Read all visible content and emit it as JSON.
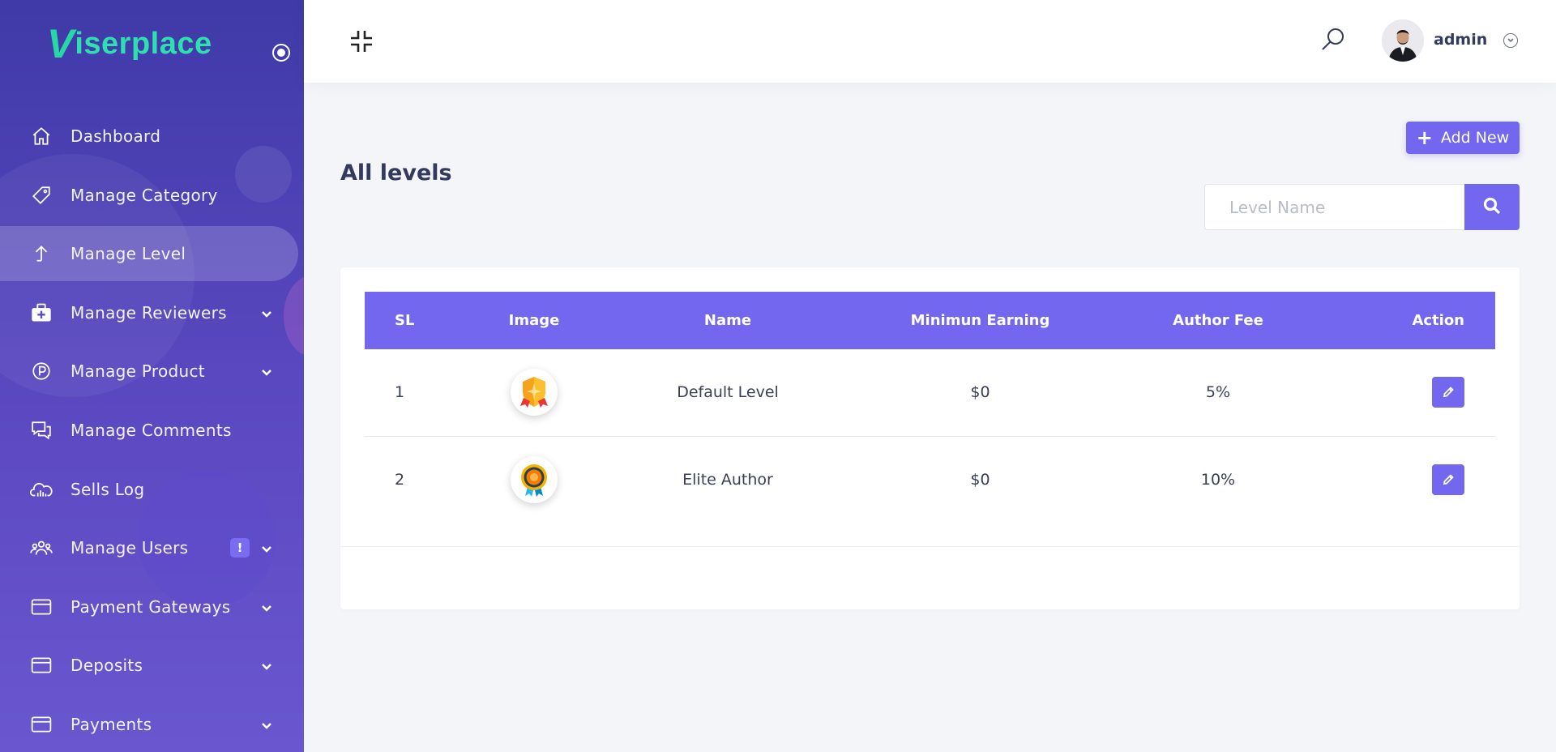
{
  "brand": {
    "logo_initial": "V",
    "logo_text": "iserplace"
  },
  "sidebar": {
    "items": [
      {
        "label": "Dashboard",
        "icon": "home-icon",
        "active": false,
        "has_submenu": false
      },
      {
        "label": "Manage Category",
        "icon": "tag-icon",
        "active": false,
        "has_submenu": false
      },
      {
        "label": "Manage Level",
        "icon": "arrow-up-icon",
        "active": true,
        "has_submenu": false
      },
      {
        "label": "Manage Reviewers",
        "icon": "medkit-icon",
        "active": false,
        "has_submenu": true
      },
      {
        "label": "Manage Product",
        "icon": "product-p-icon",
        "active": false,
        "has_submenu": true
      },
      {
        "label": "Manage Comments",
        "icon": "comments-icon",
        "active": false,
        "has_submenu": false
      },
      {
        "label": "Sells Log",
        "icon": "cloud-chart-icon",
        "active": false,
        "has_submenu": false
      },
      {
        "label": "Manage Users",
        "icon": "users-icon",
        "active": false,
        "has_submenu": true,
        "badge": "!"
      },
      {
        "label": "Payment Gateways",
        "icon": "credit-card-icon",
        "active": false,
        "has_submenu": true
      },
      {
        "label": "Deposits",
        "icon": "credit-card-icon",
        "active": false,
        "has_submenu": true
      },
      {
        "label": "Payments",
        "icon": "credit-card-icon",
        "active": false,
        "has_submenu": true
      }
    ]
  },
  "header": {
    "user_name": "admin"
  },
  "main": {
    "title": "All levels",
    "add_button_label": "Add New",
    "search_placeholder": "Level Name",
    "search_value": ""
  },
  "table": {
    "columns": [
      "SL",
      "Image",
      "Name",
      "Minimun Earning",
      "Author Fee",
      "Action"
    ],
    "rows": [
      {
        "sl": "1",
        "image": "shield-badge-icon",
        "name": "Default Level",
        "min_earning": "$0",
        "author_fee": "5%"
      },
      {
        "sl": "2",
        "image": "medal-ribbon-icon",
        "name": "Elite Author",
        "min_earning": "$0",
        "author_fee": "10%"
      }
    ]
  },
  "colors": {
    "accent": "#7367f0",
    "sidebar_top": "#3f3aa8",
    "sidebar_bottom": "#6a57cf",
    "logo": "#2ee0b0",
    "text": "#34395e"
  }
}
